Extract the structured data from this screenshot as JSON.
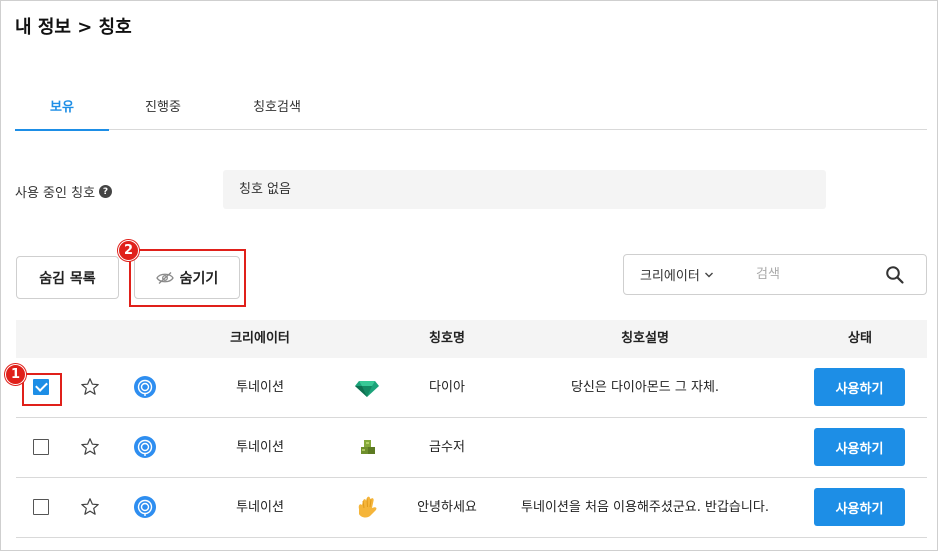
{
  "breadcrumb": "내 정보 > 칭호",
  "tabs": [
    {
      "label": "보유",
      "active": true
    },
    {
      "label": "진행중",
      "active": false
    },
    {
      "label": "칭호검색",
      "active": false
    }
  ],
  "current_title": {
    "label": "사용 중인 칭호",
    "value": "칭호 없음"
  },
  "toolbar": {
    "hidden_list_label": "숨김 목록",
    "hide_label": "숨기기"
  },
  "annotations": [
    "1",
    "2"
  ],
  "search": {
    "filter_label": "크리에이터",
    "placeholder": "검색"
  },
  "table": {
    "headers": {
      "creator": "크리에이터",
      "title_name": "칭호명",
      "description": "칭호설명",
      "status": "상태"
    },
    "rows": [
      {
        "checked": true,
        "creator": "투네이션",
        "title_icon": "diamond-icon",
        "title_name": "다이아",
        "description": "당신은 다이아몬드 그 자체.",
        "action": "사용하기"
      },
      {
        "checked": false,
        "creator": "투네이션",
        "title_icon": "money-stack-icon",
        "title_name": "금수저",
        "description": "",
        "action": "사용하기"
      },
      {
        "checked": false,
        "creator": "투네이션",
        "title_icon": "waving-hand-icon",
        "title_name": "안녕하세요",
        "description": "투네이션을 처음 이용해주셨군요. 반갑습니다.",
        "action": "사용하기"
      }
    ]
  },
  "colors": {
    "accent": "#1d8ee6",
    "annotation": "#e0201a"
  }
}
